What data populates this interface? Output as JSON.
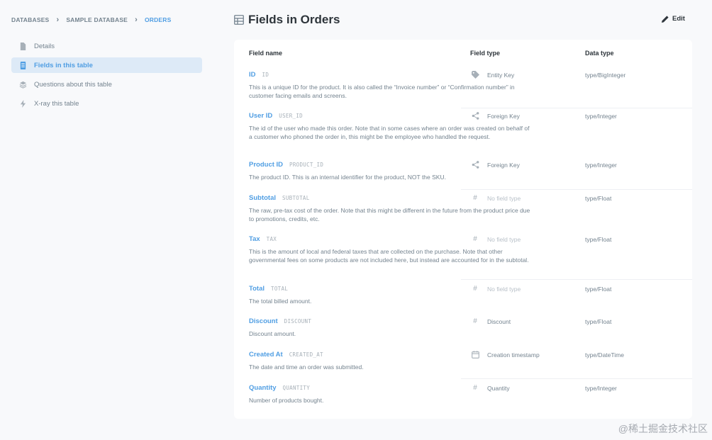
{
  "breadcrumb": {
    "items": [
      "DATABASES",
      "SAMPLE DATABASE",
      "ORDERS"
    ]
  },
  "sidebar": {
    "items": [
      {
        "label": "Details",
        "icon": "document-icon"
      },
      {
        "label": "Fields in this table",
        "icon": "table-list-icon"
      },
      {
        "label": "Questions about this table",
        "icon": "layers-icon"
      },
      {
        "label": "X-ray this table",
        "icon": "bolt-icon"
      }
    ]
  },
  "header": {
    "title": "Fields in Orders",
    "edit_label": "Edit"
  },
  "table": {
    "columns": {
      "name": "Field name",
      "type": "Field type",
      "data": "Data type"
    },
    "rows": [
      {
        "name": "ID",
        "db": "ID",
        "desc": "This is a unique ID for the product. It is also called the “Invoice number” or “Confirmation number” in customer facing emails and screens.",
        "type": "Entity Key",
        "type_icon": "tag-icon",
        "data_type": "type/BigInteger"
      },
      {
        "name": "User ID",
        "db": "USER_ID",
        "desc": "The id of the user who made this order. Note that in some cases where an order was created on behalf of a customer who phoned the order in, this might be the employee who handled the request.",
        "type": "Foreign Key",
        "type_icon": "share-icon",
        "data_type": "type/Integer"
      },
      {
        "name": "Product ID",
        "db": "PRODUCT_ID",
        "desc": "The product ID. This is an internal identifier for the product, NOT the SKU.",
        "type": "Foreign Key",
        "type_icon": "share-icon",
        "data_type": "type/Integer"
      },
      {
        "name": "Subtotal",
        "db": "SUBTOTAL",
        "desc": "The raw, pre-tax cost of the order. Note that this might be different in the future from the product price due to promotions, credits, etc.",
        "type": "No field type",
        "type_icon": "hash-icon",
        "data_type": "type/Float"
      },
      {
        "name": "Tax",
        "db": "TAX",
        "desc": "This is the amount of local and federal taxes that are collected on the purchase. Note that other governmental fees on some products are not included here, but instead are accounted for in the subtotal.",
        "type": "No field type",
        "type_icon": "hash-icon",
        "data_type": "type/Float"
      },
      {
        "name": "Total",
        "db": "TOTAL",
        "desc": "The total billed amount.",
        "type": "No field type",
        "type_icon": "hash-icon",
        "data_type": "type/Float"
      },
      {
        "name": "Discount",
        "db": "DISCOUNT",
        "desc": "Discount amount.",
        "type": "Discount",
        "type_icon": "hash-icon",
        "data_type": "type/Float"
      },
      {
        "name": "Created At",
        "db": "CREATED_AT",
        "desc": "The date and time an order was submitted.",
        "type": "Creation timestamp",
        "type_icon": "calendar-icon",
        "data_type": "type/DateTime"
      },
      {
        "name": "Quantity",
        "db": "QUANTITY",
        "desc": "Number of products bought.",
        "type": "Quantity",
        "type_icon": "hash-icon",
        "data_type": "type/Integer"
      }
    ]
  },
  "watermark": "@稀土掘金技术社区"
}
